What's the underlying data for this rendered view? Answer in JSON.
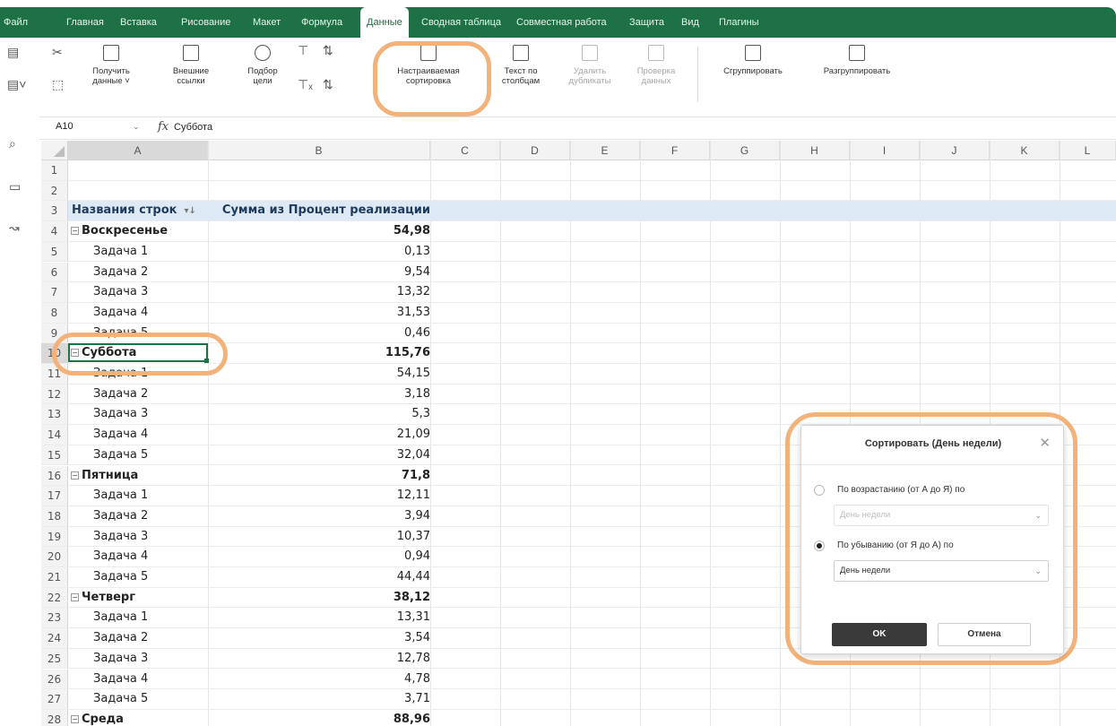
{
  "menu": {
    "items": [
      {
        "label": "Файл"
      },
      {
        "label": "Главная"
      },
      {
        "label": "Вставка"
      },
      {
        "label": "Рисование"
      },
      {
        "label": "Макет"
      },
      {
        "label": "Формула"
      },
      {
        "label": "Данные",
        "active": true
      },
      {
        "label": "Сводная таблица"
      },
      {
        "label": "Совместная работа"
      },
      {
        "label": "Защита"
      },
      {
        "label": "Вид"
      },
      {
        "label": "Плагины"
      }
    ]
  },
  "ribbon": {
    "get_data": "Получить данные ˅",
    "external_links": "Внешние ссылки",
    "goal_seek": "Подбор цели",
    "custom_sort": "Настраиваемая сортировка",
    "text_to_columns": "Текст по столбцам",
    "remove_duplicates": "Удалить дубликаты",
    "data_validation": "Проверка данных",
    "group": "Сгруппировать",
    "ungroup": "Разгруппировать"
  },
  "formula_bar": {
    "cell_ref": "A10",
    "fx": "fx",
    "value": "Суббота"
  },
  "columns": [
    "A",
    "B",
    "C",
    "D",
    "E",
    "F",
    "G",
    "H",
    "I",
    "J",
    "K",
    "L"
  ],
  "pivot": {
    "header_rows": "Названия строк",
    "header_values": "Сумма из Процент реализации"
  },
  "rows": [
    {
      "n": "1",
      "a": "",
      "b": "",
      "kind": "empty"
    },
    {
      "n": "2",
      "a": "",
      "b": "",
      "kind": "empty"
    },
    {
      "n": "3",
      "a": "",
      "b": "",
      "kind": "header"
    },
    {
      "n": "4",
      "a": "Воскресенье",
      "b": "54,98",
      "kind": "day"
    },
    {
      "n": "5",
      "a": "Задача 1",
      "b": "0,13",
      "kind": "task"
    },
    {
      "n": "6",
      "a": "Задача 2",
      "b": "9,54",
      "kind": "task"
    },
    {
      "n": "7",
      "a": "Задача 3",
      "b": "13,32",
      "kind": "task"
    },
    {
      "n": "8",
      "a": "Задача 4",
      "b": "31,53",
      "kind": "task"
    },
    {
      "n": "9",
      "a": "Задача 5",
      "b": "0,46",
      "kind": "task"
    },
    {
      "n": "10",
      "a": "Суббота",
      "b": "115,76",
      "kind": "day"
    },
    {
      "n": "11",
      "a": "Задача 1",
      "b": "54,15",
      "kind": "task"
    },
    {
      "n": "12",
      "a": "Задача 2",
      "b": "3,18",
      "kind": "task"
    },
    {
      "n": "13",
      "a": "Задача 3",
      "b": "5,3",
      "kind": "task"
    },
    {
      "n": "14",
      "a": "Задача 4",
      "b": "21,09",
      "kind": "task"
    },
    {
      "n": "15",
      "a": "Задача 5",
      "b": "32,04",
      "kind": "task"
    },
    {
      "n": "16",
      "a": "Пятница",
      "b": "71,8",
      "kind": "day"
    },
    {
      "n": "17",
      "a": "Задача 1",
      "b": "12,11",
      "kind": "task"
    },
    {
      "n": "18",
      "a": "Задача 2",
      "b": "3,94",
      "kind": "task"
    },
    {
      "n": "19",
      "a": "Задача 3",
      "b": "10,37",
      "kind": "task"
    },
    {
      "n": "20",
      "a": "Задача 4",
      "b": "0,94",
      "kind": "task"
    },
    {
      "n": "21",
      "a": "Задача 5",
      "b": "44,44",
      "kind": "task"
    },
    {
      "n": "22",
      "a": "Четверг",
      "b": "38,12",
      "kind": "day"
    },
    {
      "n": "23",
      "a": "Задача 1",
      "b": "13,31",
      "kind": "task"
    },
    {
      "n": "24",
      "a": "Задача 2",
      "b": "3,54",
      "kind": "task"
    },
    {
      "n": "25",
      "a": "Задача 3",
      "b": "12,78",
      "kind": "task"
    },
    {
      "n": "26",
      "a": "Задача 4",
      "b": "4,78",
      "kind": "task"
    },
    {
      "n": "27",
      "a": "Задача 5",
      "b": "3,71",
      "kind": "task"
    },
    {
      "n": "28",
      "a": "Среда",
      "b": "88,96",
      "kind": "day"
    }
  ],
  "dialog": {
    "title": "Сортировать (День недели)",
    "ascending_label": "По возрастанию (от А до Я) по",
    "ascending_value": "День недели",
    "descending_label": "По убыванию (от Я до А) по",
    "descending_value": "День недели",
    "selected": "descending",
    "ok_label": "OK",
    "cancel_label": "Отмена"
  },
  "colors": {
    "accent_green": "#1e7145",
    "highlight_orange": "#f2b27a",
    "pivot_header_bg": "#dde9f5"
  }
}
